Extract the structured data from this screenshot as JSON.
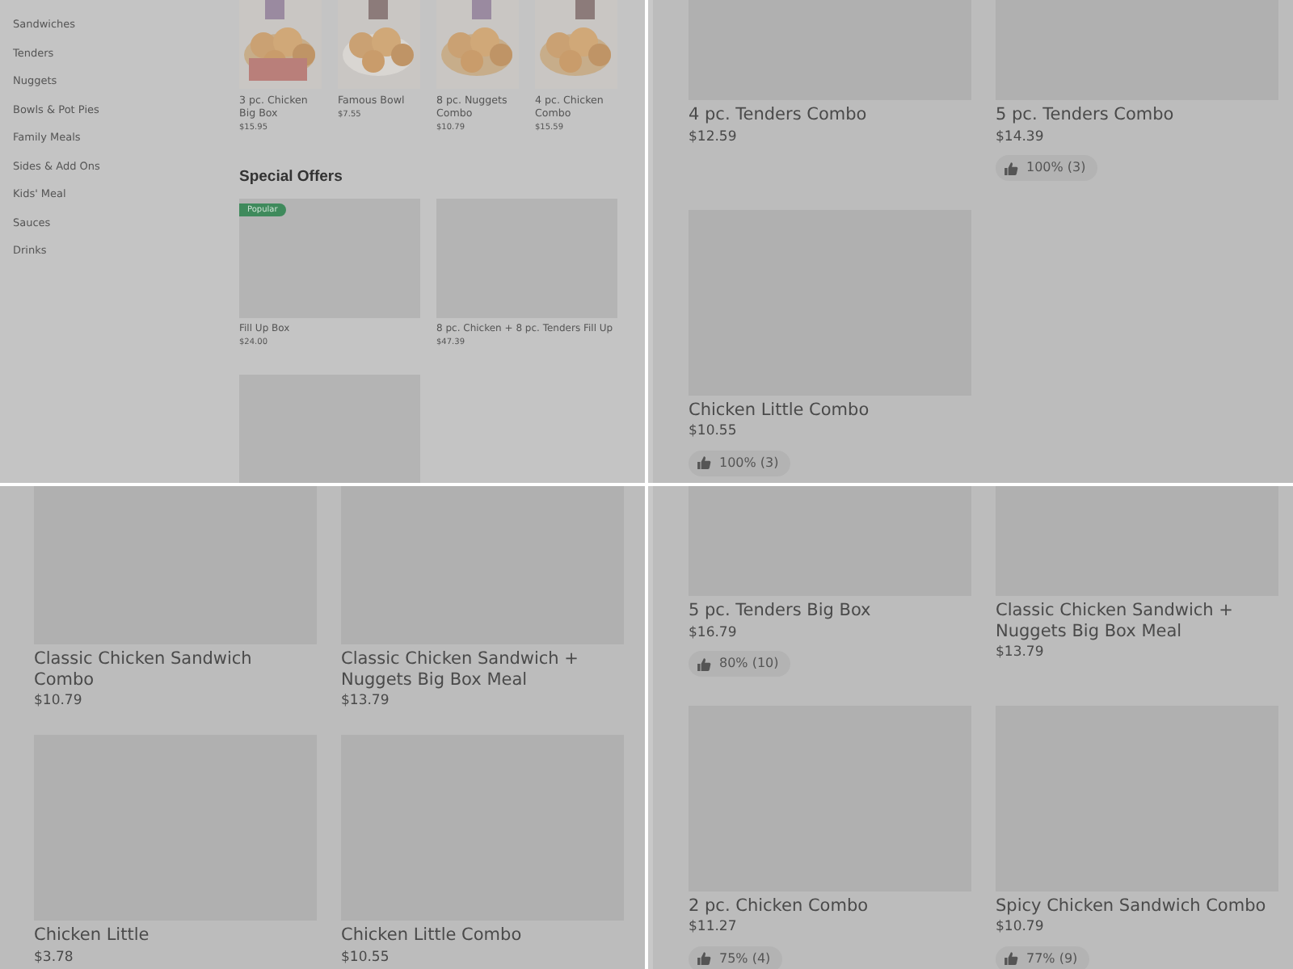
{
  "panels": [
    {
      "kind": "menu",
      "sidebar": {
        "items": [
          "Sandwiches",
          "Tenders",
          "Nuggets",
          "Bowls & Pot Pies",
          "Family Meals",
          "Sides & Add Ons",
          "Kids' Meal",
          "Sauces",
          "Drinks"
        ]
      },
      "featured": [
        {
          "name": "3 pc. Chicken Big Box",
          "price": "$15.95"
        },
        {
          "name": "Famous Bowl",
          "price": "$7.55"
        },
        {
          "name": "8 pc. Nuggets Combo",
          "price": "$10.79"
        },
        {
          "name": "4 pc. Chicken Combo",
          "price": "$15.59"
        }
      ],
      "special_offers": {
        "title": "Special Offers",
        "items": [
          {
            "kind": "offer",
            "name": "Fill Up Box",
            "price": "$24.00",
            "badge": "Popular"
          },
          {
            "kind": "offer",
            "name": "8 pc. Chicken + 8 pc. Tenders Fill Up",
            "price": "$47.39"
          },
          {
            "kind": "placeholder"
          }
        ]
      }
    },
    {
      "kind": "grid",
      "products": [
        {
          "name": "4 pc. Tenders Combo",
          "price": "$12.59"
        },
        {
          "name": "5 pc. Tenders Combo",
          "price": "$14.39",
          "rating": "100% (3)"
        },
        {
          "name": "Chicken Little Combo",
          "price": "$10.55",
          "rating": "100% (3)"
        }
      ]
    },
    {
      "kind": "grid",
      "products": [
        {
          "name": "Classic Chicken Sandwich Combo",
          "price": "$10.79"
        },
        {
          "name": "Classic Chicken Sandwich + Nuggets Big Box Meal",
          "price": "$13.79"
        },
        {
          "name": "Chicken Little",
          "price": "$3.78"
        },
        {
          "name": "Chicken Little Combo",
          "price": "$10.55"
        }
      ]
    },
    {
      "kind": "grid",
      "products": [
        {
          "name": "5 pc. Tenders Big Box",
          "price": "$16.79",
          "rating": "80% (10)"
        },
        {
          "name": "Classic Chicken Sandwich + Nuggets Big Box Meal",
          "price": "$13.79"
        },
        {
          "name": "2 pc. Chicken Combo",
          "price": "$11.27",
          "rating": "75% (4)"
        },
        {
          "name": "Spicy Chicken Sandwich Combo",
          "price": "$10.79",
          "rating": "77% (9)"
        }
      ]
    }
  ]
}
